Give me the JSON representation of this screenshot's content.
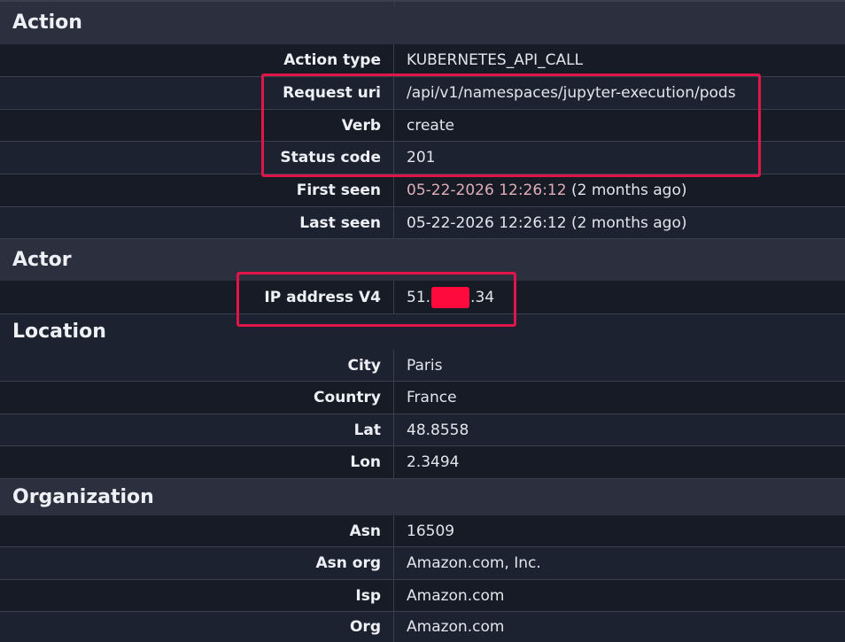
{
  "sections": {
    "action": {
      "title": "Action",
      "rows": [
        {
          "label": "Action type",
          "value": "KUBERNETES_API_CALL"
        },
        {
          "label": "Request uri",
          "value": "/api/v1/namespaces/jupyter-execution/pods"
        },
        {
          "label": "Verb",
          "value": "create"
        },
        {
          "label": "Status code",
          "value": "201"
        },
        {
          "label": "First seen",
          "value_date": "05-22-2026 12:26:12",
          "value_rel": " (2 months ago)"
        },
        {
          "label": "Last seen",
          "value": "05-22-2026 12:26:12 (2 months ago)"
        }
      ]
    },
    "actor": {
      "title": "Actor",
      "rows": [
        {
          "label": "IP address V4",
          "value_prefix": "51.",
          "value_suffix": ".34"
        }
      ]
    },
    "location": {
      "title": "Location",
      "rows": [
        {
          "label": "City",
          "value": "Paris"
        },
        {
          "label": "Country",
          "value": "France"
        },
        {
          "label": "Lat",
          "value": "48.8558"
        },
        {
          "label": "Lon",
          "value": "2.3494"
        }
      ]
    },
    "organization": {
      "title": "Organization",
      "rows": [
        {
          "label": "Asn",
          "value": "16509"
        },
        {
          "label": "Asn org",
          "value": "Amazon.com, Inc."
        },
        {
          "label": "Isp",
          "value": "Amazon.com"
        },
        {
          "label": "Org",
          "value": "Amazon.com"
        }
      ]
    }
  },
  "colors": {
    "background": "#161b26",
    "header": "#2c303e",
    "highlight": "#e0164a",
    "redaction": "#ff0a3c"
  }
}
